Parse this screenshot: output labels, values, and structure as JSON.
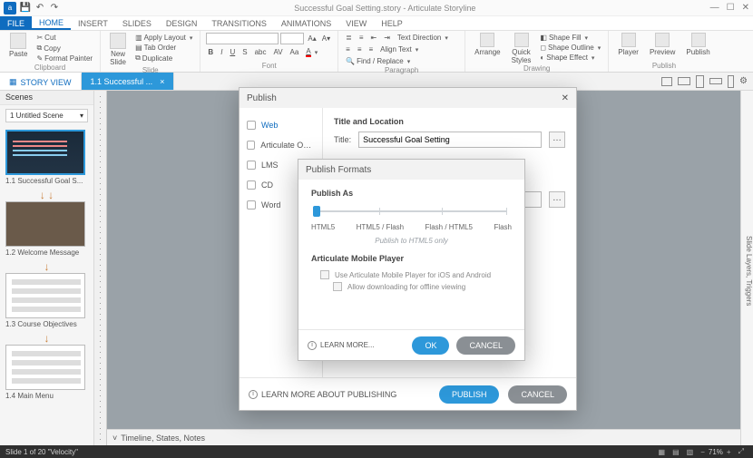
{
  "titlebar": {
    "title": "Successful Goal Setting.story - Articulate Storyline",
    "win": {
      "min": "—",
      "max": "☐",
      "close": "✕"
    }
  },
  "menuTabs": [
    "FILE",
    "HOME",
    "INSERT",
    "SLIDES",
    "DESIGN",
    "TRANSITIONS",
    "ANIMATIONS",
    "VIEW",
    "HELP"
  ],
  "ribbon": {
    "clipboard": {
      "paste": "Paste",
      "cut": "Cut",
      "copy": "Copy",
      "format": "Format Painter",
      "label": "Clipboard"
    },
    "slides": {
      "new": "New\nSlide",
      "apply": "Apply Layout",
      "tab": "Tab Order",
      "dup": "Duplicate",
      "label": "Slide"
    },
    "font": {
      "label": "Font"
    },
    "paragraph": {
      "td": "Text Direction",
      "at": "Align Text",
      "fr": "Find / Replace",
      "label": "Paragraph"
    },
    "arrange": "Arrange",
    "quick": "Quick\nStyles",
    "drawing": {
      "sf": "Shape Fill",
      "so": "Shape Outline",
      "se": "Shape Effect",
      "label": "Drawing"
    },
    "publish": {
      "player": "Player",
      "preview": "Preview",
      "publish": "Publish",
      "label": "Publish"
    }
  },
  "subtabs": {
    "story": "STORY VIEW",
    "slide": "1.1 Successful ..."
  },
  "scenes": {
    "title": "Scenes",
    "select": "1 Untitled Scene",
    "items": [
      {
        "label": "1.1 Successful Goal S...",
        "kind": "dark"
      },
      {
        "label": "1.2 Welcome Message",
        "kind": "photo"
      },
      {
        "label": "1.3 Course Objectives",
        "kind": "list"
      },
      {
        "label": "1.4 Main Menu",
        "kind": "list"
      }
    ]
  },
  "rightstrip": "Slide Layers, Triggers",
  "bottompane": {
    "chev": "˅",
    "label": "Timeline, States, Notes"
  },
  "publishDlg": {
    "title": "Publish",
    "close": "✕",
    "nav": [
      "Web",
      "Articulate Online",
      "LMS",
      "CD",
      "Word"
    ],
    "section": "Title and Location",
    "titleLabel": "Title:",
    "titleValue": "Successful Goal Setting",
    "learn": "LEARN MORE ABOUT PUBLISHING",
    "ok": "PUBLISH",
    "cancel": "CANCEL"
  },
  "formatsDlg": {
    "title": "Publish Formats",
    "label": "Publish As",
    "opts": [
      "HTML5",
      "HTML5 / Flash",
      "Flash / HTML5",
      "Flash"
    ],
    "hint": "Publish to HTML5 only",
    "ampTitle": "Articulate Mobile Player",
    "amp1": "Use Articulate Mobile Player for iOS and Android",
    "amp2": "Allow downloading for offline viewing",
    "learn": "LEARN MORE...",
    "ok": "OK",
    "cancel": "CANCEL"
  },
  "status": {
    "left": "Slide 1 of 20   \"Velocity\"",
    "zoom": "71%"
  }
}
